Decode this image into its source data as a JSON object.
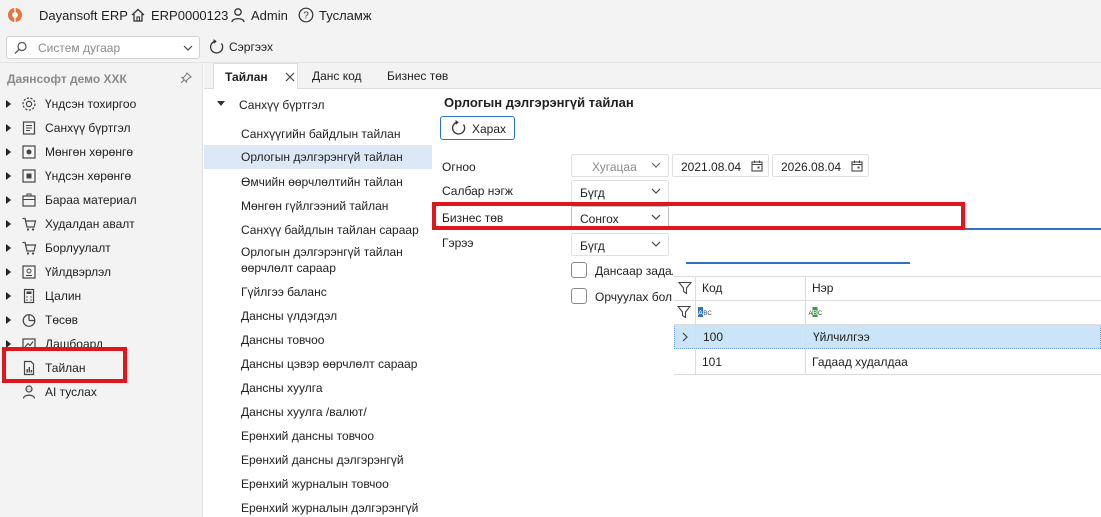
{
  "app": {
    "name": "Dayansoft ERP",
    "company_code": "ERP0000123",
    "user": "Admin",
    "help": "Тусламж"
  },
  "toolbar": {
    "search_placeholder": "Систем дугаар",
    "refresh_label": "Сэргээх"
  },
  "sidebar": {
    "company": "Даянсофт демо ХХК",
    "items": [
      {
        "label": "Үндсэн тохиргоо",
        "icon": "gear-icon"
      },
      {
        "label": "Санхүү бүртгэл",
        "icon": "ledger-icon"
      },
      {
        "label": "Мөнгөн хөрөнгө",
        "icon": "cash-icon"
      },
      {
        "label": "Үндсэн хөрөнгө",
        "icon": "asset-icon"
      },
      {
        "label": "Бараа материал",
        "icon": "box-icon"
      },
      {
        "label": "Худалдан авалт",
        "icon": "cart-icon"
      },
      {
        "label": "Борлуулалт",
        "icon": "sales-cart-icon"
      },
      {
        "label": "Үйлдвэрлэл",
        "icon": "factory-icon"
      },
      {
        "label": "Цалин",
        "icon": "calculator-icon"
      },
      {
        "label": "Төсөв",
        "icon": "pie-icon"
      },
      {
        "label": "Дашбоард",
        "icon": "dashboard-icon"
      },
      {
        "label": "Тайлан",
        "icon": "report-icon"
      },
      {
        "label": "AI туслах",
        "icon": "ai-assistant-icon"
      }
    ]
  },
  "tabs": [
    {
      "label": "Тайлан"
    },
    {
      "label": "Данс код"
    },
    {
      "label": "Бизнес төв"
    }
  ],
  "report_list": {
    "group": "Санхүү бүртгэл",
    "items": [
      "Санхүүгийн байдлын тайлан",
      "Орлогын дэлгэрэнгүй тайлан",
      "Өмчийн өөрчлөлтийн тайлан",
      "Мөнгөн гүйлгээний тайлан",
      "Санхүү байдлын тайлан сараар",
      "Орлогын дэлгэрэнгүй тайлан өөрчлөлт сараар",
      "Гүйлгээ баланс",
      "Дансны үлдэгдэл",
      "Дансны товчоо",
      "Дансны цэвэр өөрчлөлт сараар",
      "Дансны хуулга",
      "Дансны хуулга /валют/",
      "Ерөнхий дансны товчоо",
      "Ерөнхий дансны дэлгэрэнгүй",
      "Ерөнхий журналын товчоо",
      "Ерөнхий журналын дэлгэрэнгүй"
    ]
  },
  "form": {
    "title": "Орлогын дэлгэрэнгүй тайлан",
    "view_button": "Харах",
    "date_label": "Огноо",
    "period_value": "Хугацаа",
    "date_from": "2021.08.04",
    "date_to": "2026.08.04",
    "branch_label": "Салбар нэгж",
    "branch_value": "Бүгд",
    "bizcenter_label": "Бизнес төв",
    "bizcenter_value": "Сонгох",
    "contract_label": "Гэрээ",
    "contract_value": "Бүгд",
    "chk1_label": "Дансаар задал",
    "chk2_label": "Орчуулах бол"
  },
  "grid": {
    "headers": [
      "Код",
      "Нэр"
    ],
    "rows": [
      {
        "code": "100",
        "name": "Үйлчилгээ"
      },
      {
        "code": "101",
        "name": "Гадаад худалдаа"
      }
    ]
  },
  "colors": {
    "accent": "#2b73c4",
    "highlight": "#e0161c",
    "selection": "#cce4f7"
  }
}
